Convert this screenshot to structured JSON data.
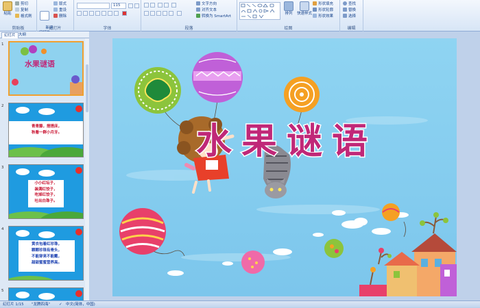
{
  "ribbon": {
    "clipboard": {
      "group": "剪贴板",
      "paste": "粘贴",
      "cut": "剪切",
      "copy": "复制",
      "format_painter": "格式刷"
    },
    "slides": {
      "group": "幻灯片",
      "new_slide": "新建\n幻灯片",
      "layout": "版式",
      "reset": "重设",
      "delete": "删除"
    },
    "font": {
      "group": "字体",
      "font_size": "115"
    },
    "paragraph": {
      "group": "段落",
      "text_direction": "文字方向",
      "align_text": "对齐文本",
      "smartart": "转换为 SmartArt"
    },
    "drawing": {
      "group": "绘图",
      "arrange": "排列",
      "quick_styles": "快速样式",
      "shape_fill": "形状填充",
      "shape_outline": "形状轮廓",
      "shape_effects": "形状效果"
    },
    "editing": {
      "group": "编辑",
      "find": "查找",
      "replace": "替换",
      "select": "选择"
    }
  },
  "panel": {
    "tabs": [
      "幻灯片",
      "大纲"
    ],
    "slides": [
      {
        "num": "1",
        "text": ""
      },
      {
        "num": "2",
        "text": "青青藤，搭搭床，\n秋看一群小月牙。"
      },
      {
        "num": "3",
        "text": "小小红坛子，\n装满红饺子，\n吃掉红饺子，\n吐出白珠子。"
      },
      {
        "num": "4",
        "text": "黄衣包着红珍珠，\n颗颗珍珠有骨头，\n不能穿来不能戴，\n甜甜蜜蜜营养高。"
      },
      {
        "num": "5",
        "text": ""
      }
    ]
  },
  "slide": {
    "title": "水果谜语"
  },
  "status": {
    "slide_index": "幻灯片 1/15",
    "theme": "\"龙腾四海\"",
    "language": "中文(简体，中国)"
  },
  "colors": {
    "sky": "#8fd2ef",
    "title_fill": "#c02878",
    "selection": "#f0a030"
  }
}
